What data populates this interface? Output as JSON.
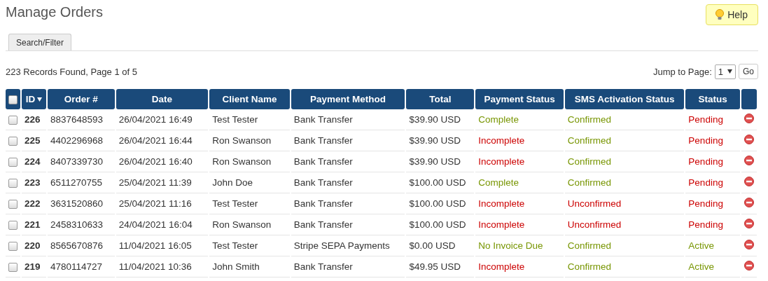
{
  "title": "Manage Orders",
  "help_button": "Help",
  "tabs": [
    {
      "label": "Search/Filter",
      "selected": false
    }
  ],
  "records_info": "223 Records Found, Page 1 of 5",
  "pagination": {
    "label": "Jump to Page:",
    "page": "1",
    "go_button": "Go"
  },
  "table": {
    "select_all_checked": false,
    "columns": [
      {
        "label": "ID",
        "sorted": true
      },
      {
        "label": "Order #",
        "sorted": false
      },
      {
        "label": "Date",
        "sorted": false
      },
      {
        "label": "Client Name",
        "sorted": false
      },
      {
        "label": "Payment Method",
        "sorted": false
      },
      {
        "label": "Total",
        "sorted": false
      },
      {
        "label": "Payment Status",
        "sorted": false
      },
      {
        "label": "SMS Activation Status",
        "sorted": false
      },
      {
        "label": "Status",
        "sorted": false
      }
    ],
    "rows": [
      {
        "checked": false,
        "id": "226",
        "order": "8837648593",
        "date": "26/04/2021 16:49",
        "client": "Test Tester",
        "method": "Bank Transfer",
        "total": "$39.90 USD",
        "payment_status": {
          "text": "Complete",
          "color": "#779500"
        },
        "sms_status": {
          "text": "Confirmed",
          "color": "#779500"
        },
        "status": {
          "text": "Pending",
          "color": "#cc0000"
        }
      },
      {
        "checked": false,
        "id": "225",
        "order": "4402296968",
        "date": "26/04/2021 16:44",
        "client": "Ron Swanson",
        "method": "Bank Transfer",
        "total": "$39.90 USD",
        "payment_status": {
          "text": "Incomplete",
          "color": "#cc0000"
        },
        "sms_status": {
          "text": "Confirmed",
          "color": "#779500"
        },
        "status": {
          "text": "Pending",
          "color": "#cc0000"
        }
      },
      {
        "checked": false,
        "id": "224",
        "order": "8407339730",
        "date": "26/04/2021 16:40",
        "client": "Ron Swanson",
        "method": "Bank Transfer",
        "total": "$39.90 USD",
        "payment_status": {
          "text": "Incomplete",
          "color": "#cc0000"
        },
        "sms_status": {
          "text": "Confirmed",
          "color": "#779500"
        },
        "status": {
          "text": "Pending",
          "color": "#cc0000"
        }
      },
      {
        "checked": false,
        "id": "223",
        "order": "6511270755",
        "date": "25/04/2021 11:39",
        "client": "John Doe",
        "method": "Bank Transfer",
        "total": "$100.00 USD",
        "payment_status": {
          "text": "Complete",
          "color": "#779500"
        },
        "sms_status": {
          "text": "Confirmed",
          "color": "#779500"
        },
        "status": {
          "text": "Pending",
          "color": "#cc0000"
        }
      },
      {
        "checked": false,
        "id": "222",
        "order": "3631520860",
        "date": "25/04/2021 11:16",
        "client": "Test Tester",
        "method": "Bank Transfer",
        "total": "$100.00 USD",
        "payment_status": {
          "text": "Incomplete",
          "color": "#cc0000"
        },
        "sms_status": {
          "text": "Unconfirmed",
          "color": "#cc0000"
        },
        "status": {
          "text": "Pending",
          "color": "#cc0000"
        }
      },
      {
        "checked": false,
        "id": "221",
        "order": "2458310633",
        "date": "24/04/2021 16:04",
        "client": "Ron Swanson",
        "method": "Bank Transfer",
        "total": "$100.00 USD",
        "payment_status": {
          "text": "Incomplete",
          "color": "#cc0000"
        },
        "sms_status": {
          "text": "Unconfirmed",
          "color": "#cc0000"
        },
        "status": {
          "text": "Pending",
          "color": "#cc0000"
        }
      },
      {
        "checked": false,
        "id": "220",
        "order": "8565670876",
        "date": "11/04/2021 16:05",
        "client": "Test Tester",
        "method": "Stripe SEPA Payments",
        "total": "$0.00 USD",
        "payment_status": {
          "text": "No Invoice Due",
          "color": "#779500"
        },
        "sms_status": {
          "text": "Confirmed",
          "color": "#779500"
        },
        "status": {
          "text": "Active",
          "color": "#779500"
        }
      },
      {
        "checked": false,
        "id": "219",
        "order": "4780114727",
        "date": "11/04/2021 10:36",
        "client": "John Smith",
        "method": "Bank Transfer",
        "total": "$49.95 USD",
        "payment_status": {
          "text": "Incomplete",
          "color": "#cc0000"
        },
        "sms_status": {
          "text": "Confirmed",
          "color": "#779500"
        },
        "status": {
          "text": "Active",
          "color": "#779500"
        }
      }
    ]
  }
}
